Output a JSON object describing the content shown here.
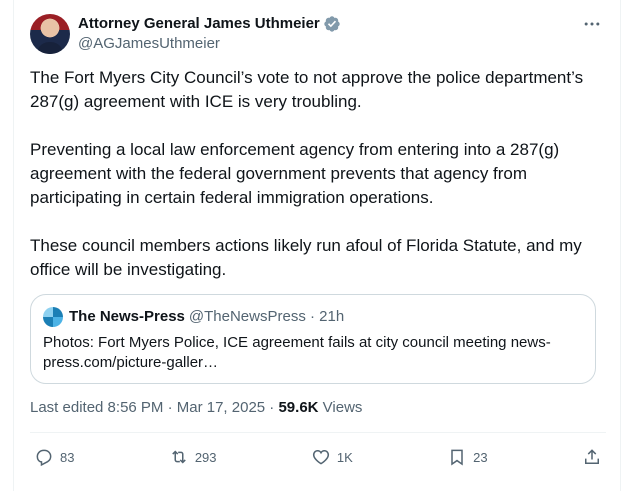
{
  "author": {
    "display_name": "Attorney General James Uthmeier",
    "handle": "@AGJamesUthmeier"
  },
  "more_icon": "more-horizontal-icon",
  "post_text": "The Fort Myers City Council’s vote to not approve the police department’s 287(g) agreement with ICE is very troubling.\n\nPreventing a local law enforcement agency from entering into a 287(g) agreement with the federal government prevents that agency from participating in certain federal immigration operations.\n\nThese council members actions likely run afoul of Florida Statute, and my office will be investigating.",
  "quote": {
    "name": "The News-Press",
    "meta": "@TheNewsPress · 21h",
    "text": "Photos: Fort Myers Police, ICE agreement fails at city council meeting news-press.com/picture-galler…"
  },
  "meta": {
    "edited": "Last edited 8:56 PM · Mar 17, 2025 · ",
    "views_count": "59.6K",
    "views_label": " Views"
  },
  "actions": {
    "replies": "83",
    "reposts": "293",
    "likes": "1K",
    "bookmarks": "23"
  },
  "colors": {
    "text": "#0f1419",
    "secondary": "#536471",
    "verified": "#829aab",
    "border": "#cfd9de"
  }
}
